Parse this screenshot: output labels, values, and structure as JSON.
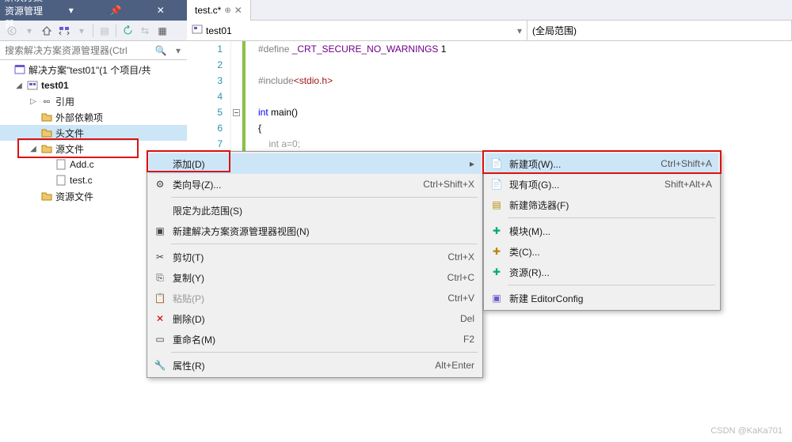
{
  "panel": {
    "title": "解决方案资源管理器"
  },
  "search": {
    "placeholder": "搜索解决方案资源管理器(Ctrl"
  },
  "tree": {
    "solution": "解决方案\"test01\"(1 个项目/共",
    "project": "test01",
    "refs": "引用",
    "external": "外部依赖项",
    "headers": "头文件",
    "sources": "源文件",
    "file_add": "Add.c",
    "file_test": "test.c",
    "resources": "资源文件"
  },
  "tab": {
    "name": "test.c*"
  },
  "nav": {
    "scope": "test01",
    "scope2": "(全局范围)"
  },
  "code": {
    "l1a": "#define ",
    "l1b": "_CRT_SECURE_NO_WARNINGS",
    "l1c": " 1",
    "l3a": "#include",
    "l3b": "<stdio.h>",
    "l5a": "int",
    "l5b": " main()",
    "l6": "{",
    "l7": "    int a=0;"
  },
  "menu1": {
    "add": "添加(D)",
    "wizard": "类向导(Z)...",
    "wizard_sc": "Ctrl+Shift+X",
    "scope": "限定为此范围(S)",
    "newview": "新建解决方案资源管理器视图(N)",
    "cut": "剪切(T)",
    "cut_sc": "Ctrl+X",
    "copy": "复制(Y)",
    "copy_sc": "Ctrl+C",
    "paste": "粘贴(P)",
    "paste_sc": "Ctrl+V",
    "delete": "删除(D)",
    "delete_sc": "Del",
    "rename": "重命名(M)",
    "rename_sc": "F2",
    "props": "属性(R)",
    "props_sc": "Alt+Enter"
  },
  "menu2": {
    "newitem": "新建项(W)...",
    "newitem_sc": "Ctrl+Shift+A",
    "existitem": "现有项(G)...",
    "existitem_sc": "Shift+Alt+A",
    "newfilter": "新建筛选器(F)",
    "module": "模块(M)...",
    "class": "类(C)...",
    "resource": "资源(R)...",
    "editorconfig": "新建 EditorConfig"
  },
  "watermark": "CSDN @KaKa701"
}
